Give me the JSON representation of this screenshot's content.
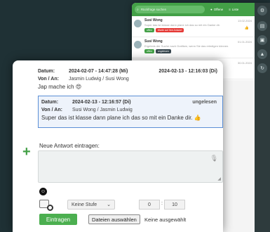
{
  "background_app": {
    "search_placeholder": "Rückfrage suchen",
    "filter_open": "Offene",
    "filter_list": "Liste",
    "messages": [
      {
        "name": "Susi Wong",
        "preview": "Super das ist klasse dann plane ich das so mit ein Danke dir.",
        "date": "13.02.2024",
        "tags": [
          "offen",
          "Warte auf Ihre Antwort"
        ]
      },
      {
        "name": "Susi Wong",
        "preview": "Ergebnis der Suche nach Grafiken, wenn Sie das erledigen können.",
        "date": "01.01.2024",
        "tags": [
          "offen",
          "ungelesen"
        ]
      },
      {
        "name": "Susi Wong",
        "preview": "",
        "date": "30.01.2024",
        "tags": []
      }
    ]
  },
  "entry1": {
    "date_label": "Datum:",
    "date_value": "2024-02-07 - 14:47:28 (Mi)",
    "date_right": "2024-02-13 - 12:16:03 (Di)",
    "from_to_label": "Von / An:",
    "from_to_value": "Jasmin Ludwig / Susi Wong",
    "text": "Jap mache ich",
    "emoji": "😍"
  },
  "entry2": {
    "date_label": "Datum:",
    "date_value": "2024-02-13 - 12:16:57 (Di)",
    "status": "ungelesen",
    "from_to_label": "Von / An:",
    "from_to_value": "Susi Wong / Jasmin Ludwig",
    "text": "Super das ist klasse dann plane ich das so mit ein Danke dir.",
    "emoji": "👍"
  },
  "reply": {
    "label": "Neue Antwort eintragen:",
    "placeholder": "",
    "level_selected": "Keine Stufe",
    "hours": "0",
    "minutes": "10",
    "time_separator": ":",
    "submit_label": "Eintragen",
    "file_button_label": "Dateien auswählen",
    "file_status": "Keine ausgewählt"
  },
  "colors": {
    "accent_green": "#43a047",
    "selected_border": "#5b8fd6",
    "background": "#1f3135"
  },
  "icons": {
    "search": "search-icon",
    "mic": "microphone-icon",
    "emoji": "emoji-icon",
    "attach": "attachment-icon",
    "add": "plus-icon",
    "dropdown": "chevron-down-icon"
  }
}
